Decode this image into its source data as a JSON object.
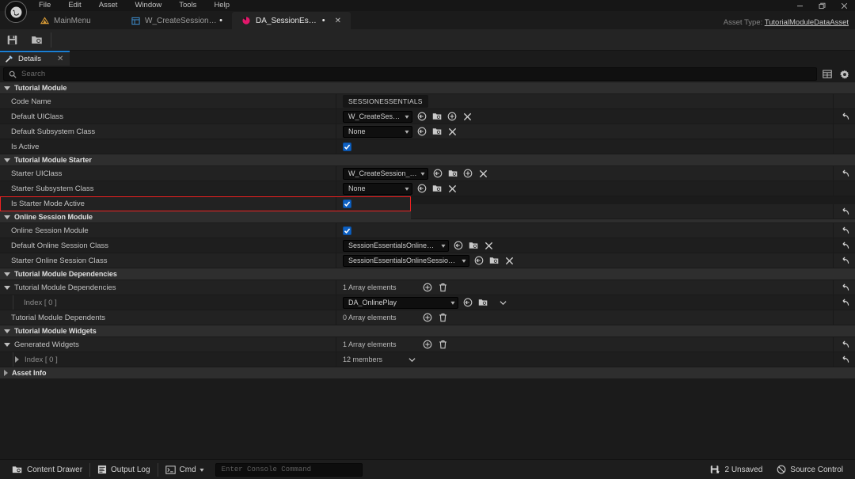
{
  "window": {
    "title": "Unreal Editor",
    "menu": [
      "File",
      "Edit",
      "Asset",
      "Window",
      "Tools",
      "Help"
    ],
    "controls": {
      "minimize": "─",
      "maximize": "❐",
      "close": "✕"
    },
    "logo_icon": "unreal-engine-logo"
  },
  "tabs": [
    {
      "label": "MainMenu",
      "icon": "level-icon",
      "dirty": "",
      "active": false,
      "closable": false
    },
    {
      "label": "W_CreateSession_Sta…",
      "icon": "widget-blueprint-icon",
      "dirty": "•",
      "active": false,
      "closable": false
    },
    {
      "label": "DA_SessionEssentials",
      "icon": "data-asset-icon",
      "dirty": "•",
      "active": true,
      "closable": true
    }
  ],
  "asset_type": {
    "prefix": "Asset Type:",
    "value": "TutorialModuleDataAsset"
  },
  "toolbar": {
    "save_label": "Save",
    "browse_label": "Browse"
  },
  "panel": {
    "tab_label": "Details",
    "close": "✕"
  },
  "search": {
    "placeholder": "Search",
    "value": ""
  },
  "search_actions": {
    "columns": "column-layout-icon",
    "settings": "gear-icon"
  },
  "colors": {
    "accent_blue": "#1a7fd4",
    "checkbox_blue": "#0e61c4",
    "highlight_red": "#ee2222",
    "data_asset_pink": "#e3176b",
    "panel_bg": "#1b1b1b",
    "category_bg": "#2e2e2e"
  },
  "properties": [
    {
      "category": "Tutorial Module",
      "rows": [
        {
          "label": "Code Name",
          "indent": 1,
          "widget": "tag",
          "value": "SESSIONESSENTIALS",
          "reset": false,
          "actions": []
        },
        {
          "label": "Default UIClass",
          "indent": 1,
          "widget": "combo",
          "value": "W_CreateSession",
          "combo_width": 88,
          "reset": true,
          "actions": [
            "browse-asset-icon",
            "find-in-content-browser-icon",
            "use-selected-icon",
            "clear-icon"
          ]
        },
        {
          "label": "Default Subsystem Class",
          "indent": 1,
          "widget": "combo",
          "value": "None",
          "combo_width": 88,
          "reset": false,
          "actions": [
            "browse-asset-icon",
            "find-in-content-browser-icon",
            "clear-icon"
          ]
        },
        {
          "label": "Is Active",
          "indent": 1,
          "widget": "checkbox",
          "value": true,
          "reset": false,
          "actions": []
        }
      ]
    },
    {
      "category": "Tutorial Module Starter",
      "rows": [
        {
          "label": "Starter UIClass",
          "indent": 1,
          "widget": "combo",
          "value": "W_CreateSession_Starter",
          "combo_width": 108,
          "reset": true,
          "actions": [
            "browse-asset-icon",
            "find-in-content-browser-icon",
            "use-selected-icon",
            "clear-icon"
          ]
        },
        {
          "label": "Starter Subsystem Class",
          "indent": 1,
          "widget": "combo",
          "value": "None",
          "combo_width": 88,
          "reset": false,
          "actions": [
            "browse-asset-icon",
            "find-in-content-browser-icon",
            "clear-icon"
          ]
        },
        {
          "label": "Is Starter Mode Active",
          "indent": 1,
          "widget": "checkbox",
          "value": true,
          "reset": true,
          "highlight": true,
          "actions": []
        }
      ]
    },
    {
      "category": "Online Session Module",
      "rows": [
        {
          "label": "Online Session Module",
          "indent": 1,
          "widget": "checkbox",
          "value": true,
          "reset": true,
          "actions": []
        },
        {
          "label": "Default Online Session Class",
          "indent": 1,
          "widget": "combo",
          "value": "SessionEssentialsOnlineSession",
          "combo_width": 134,
          "reset": true,
          "actions": [
            "browse-asset-icon",
            "find-in-content-browser-icon",
            "clear-icon"
          ]
        },
        {
          "label": "Starter Online Session Class",
          "indent": 1,
          "widget": "combo",
          "value": "SessionEssentialsOnlineSession_Starter",
          "combo_width": 160,
          "reset": true,
          "actions": [
            "browse-asset-icon",
            "find-in-content-browser-icon",
            "clear-icon"
          ]
        }
      ]
    },
    {
      "category": "Tutorial Module Dependencies",
      "rows": [
        {
          "label": "Tutorial Module Dependencies",
          "indent": 1,
          "expander": "down",
          "widget": "array",
          "value": "1 Array elements",
          "reset": true,
          "actions": [
            "add-element-icon",
            "delete-all-icon"
          ]
        },
        {
          "label": "Index [ 0 ]",
          "indent": 2,
          "dim": true,
          "widget": "combo",
          "value": "DA_OnlinePlay",
          "combo_width": 146,
          "reset": true,
          "actions": [
            "browse-asset-icon",
            "find-in-content-browser-icon",
            "element-menu-icon"
          ]
        },
        {
          "label": "Tutorial Module Dependents",
          "indent": 1,
          "widget": "array",
          "value": "0 Array elements",
          "reset": false,
          "actions": [
            "add-element-icon",
            "delete-all-icon"
          ]
        }
      ]
    },
    {
      "category": "Tutorial Module Widgets",
      "rows": [
        {
          "label": "Generated Widgets",
          "indent": 1,
          "expander": "down",
          "widget": "array",
          "value": "1 Array elements",
          "reset": true,
          "actions": [
            "add-element-icon",
            "delete-all-icon"
          ]
        },
        {
          "label": "Index [ 0 ]",
          "indent": 2,
          "dim": true,
          "expander": "right",
          "widget": "members",
          "value": "12 members",
          "reset": true,
          "actions": [
            "element-menu-icon"
          ]
        }
      ]
    }
  ],
  "collapsed_category": {
    "label": "Asset Info",
    "expander": "right"
  },
  "statusbar": {
    "content_drawer": "Content Drawer",
    "output_log": "Output Log",
    "cmd": "Cmd",
    "console_placeholder": "Enter Console Command",
    "unsaved": "2 Unsaved",
    "source_control": "Source Control"
  }
}
